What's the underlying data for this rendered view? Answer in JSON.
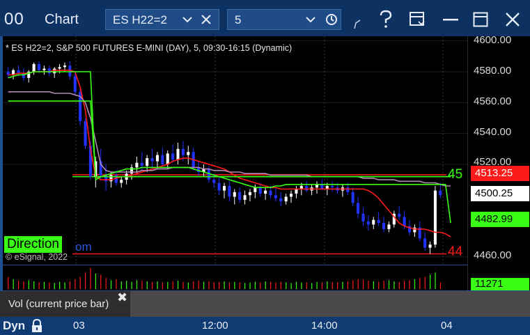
{
  "window": {
    "app_icon_text": "00",
    "title": "Chart",
    "symbol": "ES H22=2",
    "interval": "5"
  },
  "legend_text": "* ES H22=2, S&P 500 FUTURES E-MINI (DAY), 5, 09:30-16:15 (Dynamic)",
  "copyright": "© eSignal, 2022",
  "study_label": "Direction",
  "study_label_tail": "om",
  "right_edge_labels": {
    "upper": "45",
    "lower": "44"
  },
  "price_scale": {
    "ticks": [
      "4600.00",
      "4580.00",
      "4560.00",
      "4540.00",
      "4520.00",
      "4460.00"
    ],
    "badges": [
      {
        "text": "4513.25",
        "bg": "#ff1a1a",
        "fg": "#ffffff"
      },
      {
        "text": "4500.25",
        "bg": "#ffffff",
        "fg": "#000000"
      },
      {
        "text": "4482.99",
        "bg": "#39ff14",
        "fg": "#000000"
      }
    ],
    "volume_badge": {
      "text": "11271",
      "bg": "#39ff14",
      "fg": "#000000"
    }
  },
  "volume_study": {
    "caption": "Vol (current price bar)"
  },
  "time_axis": {
    "mode_label": "Dyn",
    "labels": [
      "03",
      "12:00",
      "14:00",
      "04"
    ]
  },
  "colors": {
    "accent_green": "#39ff14",
    "accent_red": "#ff1a1a",
    "up_candle": "#ffffff",
    "down_candle": "#2233ff",
    "titlebar": "#0d3160"
  },
  "chart_data": {
    "type": "candlestick",
    "x_labels": [
      "03",
      "12:00",
      "14:00",
      "04"
    ],
    "y_ticks": [
      4600,
      4580,
      4560,
      4540,
      4520,
      4460
    ],
    "ylim": [
      4455,
      4603
    ],
    "last_price": 4500.25,
    "series": [
      {
        "name": "",
        "color": "#ff1a1a",
        "values": [
          4578,
          4578,
          4579,
          4579,
          4579,
          4580,
          4580,
          4580,
          4580,
          4581,
          4581,
          4581,
          4581,
          4580,
          4570,
          4555,
          4530,
          4512,
          4510,
          4510,
          4510,
          4511,
          4512,
          4512,
          4513,
          4514,
          4515,
          4516,
          4517,
          4518,
          4519,
          4520,
          4522,
          4523,
          4524,
          4524,
          4523,
          4522,
          4521,
          4520,
          4519,
          4518,
          4517,
          4515,
          4513,
          4511,
          4510,
          4509,
          4508,
          4507,
          4506,
          4505,
          4505,
          4504,
          4504,
          4504,
          4504,
          4504,
          4504,
          4504,
          4504,
          4504,
          4504,
          4504,
          4504,
          4504,
          4504,
          4504,
          4504,
          4504,
          4503,
          4501,
          4498,
          4494,
          4490,
          4486,
          4482,
          4480,
          4479,
          4478,
          4478,
          4478,
          4477,
          4476,
          4476,
          4475,
          4473
        ]
      },
      {
        "name": "",
        "color": "#b48ab4",
        "values": [
          4567,
          4567,
          4567,
          4567,
          4567,
          4567,
          4567,
          4567,
          4567,
          4566,
          4566,
          4566,
          4566,
          4565,
          4564,
          4560,
          4550,
          4535,
          4520,
          4516,
          4515,
          4515,
          4515,
          4515,
          4515,
          4515,
          4516,
          4516,
          4516,
          4517,
          4517,
          4517,
          4518,
          4518,
          4518,
          4518,
          4518,
          4518,
          4517,
          4517,
          4516,
          4516,
          4516,
          4515,
          4515,
          4515,
          4514,
          4514,
          4514,
          4514,
          4514,
          4513,
          4513,
          4513,
          4513,
          4513,
          4513,
          4513,
          4513,
          4512,
          4512,
          4512,
          4512,
          4512,
          4512,
          4512,
          4512,
          4512,
          4512,
          4511,
          4511,
          4511,
          4510,
          4510,
          4510,
          4510,
          4509,
          4509,
          4509,
          4509,
          4509,
          4508,
          4508,
          4508,
          4507,
          4506,
          4506
        ]
      },
      {
        "name": "",
        "color": "#39ff14",
        "values": [
          4576,
          4577,
          4578,
          4578,
          4579,
          4580,
          4580,
          4580,
          4580,
          4580,
          4580,
          4580,
          4580,
          4580,
          4580,
          4580,
          4580,
          4510,
          4512,
          4513,
          4514,
          4515,
          4516,
          4517,
          4517,
          4517,
          4518,
          4518,
          4518,
          4518,
          4518,
          4518,
          4518,
          4518,
          4518,
          4518,
          4517,
          4516,
          4515,
          4514,
          4513,
          4512,
          4511,
          4510,
          4509,
          4508,
          4507,
          4506,
          4505,
          4505,
          4505,
          4505,
          4506,
          4506,
          4507,
          4507,
          4507,
          4507,
          4507,
          4507,
          4507,
          4507,
          4507,
          4507,
          4507,
          4507,
          4507,
          4507,
          4507,
          4507,
          4507,
          4507,
          4507,
          4507,
          4507,
          4507,
          4507,
          4507,
          4507,
          4507,
          4507,
          4507,
          4507,
          4507,
          4507,
          4507,
          4482
        ]
      },
      {
        "name": "",
        "color": "#39ff14",
        "values": [
          4561,
          4561,
          4561,
          4561,
          4561,
          4561,
          4561,
          4561,
          4561,
          4561,
          4561,
          4561,
          4561,
          4561,
          4561,
          4561,
          4561,
          4512,
          4512,
          4512,
          4512,
          4512,
          4512,
          4512,
          4512,
          4512,
          4512,
          4512,
          4512,
          4512,
          4512,
          4512,
          4512,
          4512,
          4512,
          4512,
          4512,
          4512,
          4512,
          4512,
          4512,
          4512,
          4512,
          4512,
          4512,
          4512,
          4512,
          4512,
          4512,
          4512,
          4512,
          4512,
          4512,
          4512,
          4512,
          4512,
          4512,
          4512,
          4512,
          4512,
          4512,
          4512,
          4512,
          4512,
          4512,
          4512,
          4512,
          4512,
          4512,
          4512,
          4512,
          4512,
          4512,
          4512,
          4512,
          4512,
          4512,
          4512,
          4512,
          4512,
          4512,
          4512,
          4512,
          4512,
          4512,
          4512,
          4512
        ]
      }
    ],
    "reference_lines": [
      {
        "value": 4513.25,
        "color": "#ff1a1a"
      },
      {
        "value": 4512,
        "color": "#39ff14"
      },
      {
        "value": 4462,
        "color": "#ff1a1a"
      }
    ],
    "candles": [
      [
        4580,
        4583,
        4576,
        4578
      ],
      [
        4578,
        4582,
        4575,
        4581
      ],
      [
        4581,
        4584,
        4577,
        4579
      ],
      [
        4579,
        4582,
        4574,
        4576
      ],
      [
        4576,
        4581,
        4573,
        4580
      ],
      [
        4580,
        4586,
        4578,
        4585
      ],
      [
        4585,
        4587,
        4579,
        4581
      ],
      [
        4581,
        4584,
        4578,
        4582
      ],
      [
        4582,
        4584,
        4577,
        4579
      ],
      [
        4579,
        4583,
        4576,
        4582
      ],
      [
        4582,
        4585,
        4579,
        4583
      ],
      [
        4583,
        4586,
        4580,
        4584
      ],
      [
        4584,
        4587,
        4575,
        4577
      ],
      [
        4577,
        4580,
        4565,
        4567
      ],
      [
        4567,
        4570,
        4545,
        4548
      ],
      [
        4548,
        4550,
        4530,
        4532
      ],
      [
        4532,
        4535,
        4510,
        4512
      ],
      [
        4512,
        4525,
        4505,
        4522
      ],
      [
        4522,
        4530,
        4510,
        4513
      ],
      [
        4513,
        4520,
        4503,
        4509
      ],
      [
        4509,
        4515,
        4505,
        4513
      ],
      [
        4513,
        4516,
        4506,
        4508
      ],
      [
        4508,
        4512,
        4505,
        4510
      ],
      [
        4510,
        4516,
        4507,
        4514
      ],
      [
        4514,
        4520,
        4510,
        4518
      ],
      [
        4518,
        4525,
        4514,
        4521
      ],
      [
        4521,
        4528,
        4516,
        4519
      ],
      [
        4519,
        4526,
        4515,
        4524
      ],
      [
        4524,
        4530,
        4518,
        4522
      ],
      [
        4522,
        4528,
        4517,
        4526
      ],
      [
        4526,
        4531,
        4519,
        4520
      ],
      [
        4520,
        4529,
        4517,
        4527
      ],
      [
        4527,
        4533,
        4521,
        4523
      ],
      [
        4523,
        4534,
        4520,
        4530
      ],
      [
        4530,
        4535,
        4522,
        4526
      ],
      [
        4526,
        4532,
        4520,
        4528
      ],
      [
        4528,
        4531,
        4516,
        4518
      ],
      [
        4518,
        4522,
        4512,
        4515
      ],
      [
        4515,
        4520,
        4512,
        4517
      ],
      [
        4517,
        4519,
        4508,
        4510
      ],
      [
        4510,
        4514,
        4505,
        4508
      ],
      [
        4508,
        4512,
        4500,
        4503
      ],
      [
        4503,
        4508,
        4498,
        4506
      ],
      [
        4506,
        4509,
        4496,
        4499
      ],
      [
        4499,
        4504,
        4494,
        4502
      ],
      [
        4502,
        4505,
        4495,
        4497
      ],
      [
        4497,
        4503,
        4494,
        4500
      ],
      [
        4500,
        4504,
        4496,
        4502
      ],
      [
        4502,
        4507,
        4498,
        4505
      ],
      [
        4505,
        4508,
        4499,
        4501
      ],
      [
        4501,
        4505,
        4497,
        4503
      ],
      [
        4503,
        4506,
        4498,
        4500
      ],
      [
        4500,
        4505,
        4496,
        4498
      ],
      [
        4498,
        4502,
        4493,
        4496
      ],
      [
        4496,
        4501,
        4494,
        4499
      ],
      [
        4499,
        4503,
        4495,
        4501
      ],
      [
        4501,
        4506,
        4498,
        4504
      ],
      [
        4504,
        4508,
        4500,
        4506
      ],
      [
        4506,
        4509,
        4502,
        4503
      ],
      [
        4503,
        4507,
        4500,
        4505
      ],
      [
        4505,
        4509,
        4501,
        4507
      ],
      [
        4507,
        4510,
        4503,
        4504
      ],
      [
        4504,
        4508,
        4500,
        4506
      ],
      [
        4506,
        4509,
        4502,
        4505
      ],
      [
        4505,
        4508,
        4501,
        4503
      ],
      [
        4503,
        4507,
        4499,
        4505
      ],
      [
        4505,
        4508,
        4500,
        4502
      ],
      [
        4502,
        4505,
        4493,
        4495
      ],
      [
        4495,
        4499,
        4485,
        4488
      ],
      [
        4488,
        4492,
        4480,
        4483
      ],
      [
        4483,
        4487,
        4477,
        4481
      ],
      [
        4481,
        4486,
        4478,
        4484
      ],
      [
        4484,
        4489,
        4480,
        4482
      ],
      [
        4482,
        4486,
        4476,
        4478
      ],
      [
        4478,
        4483,
        4476,
        4481
      ],
      [
        4481,
        4490,
        4479,
        4488
      ],
      [
        4488,
        4493,
        4484,
        4486
      ],
      [
        4486,
        4490,
        4478,
        4480
      ],
      [
        4480,
        4484,
        4474,
        4476
      ],
      [
        4476,
        4481,
        4473,
        4479
      ],
      [
        4479,
        4483,
        4470,
        4472
      ],
      [
        4472,
        4476,
        4464,
        4466
      ],
      [
        4466,
        4470,
        4462,
        4468
      ],
      [
        4468,
        4506,
        4466,
        4503
      ],
      [
        4503,
        4508,
        4498,
        4500
      ]
    ],
    "volume": [
      22,
      18,
      15,
      14,
      16,
      14,
      12,
      13,
      12,
      11,
      13,
      12,
      14,
      18,
      22,
      30,
      38,
      28,
      26,
      20,
      16,
      18,
      14,
      15,
      13,
      16,
      15,
      14,
      13,
      14,
      12,
      13,
      14,
      15,
      13,
      12,
      14,
      15,
      13,
      14,
      12,
      13,
      14,
      12,
      13,
      12,
      11,
      12,
      13,
      12,
      14,
      13,
      12,
      13,
      12,
      11,
      13,
      12,
      12,
      11,
      13,
      12,
      14,
      13,
      12,
      13,
      14,
      16,
      18,
      17,
      15,
      14,
      13,
      15,
      16,
      14,
      13,
      15,
      16,
      18,
      20,
      22,
      26,
      30,
      12
    ]
  }
}
